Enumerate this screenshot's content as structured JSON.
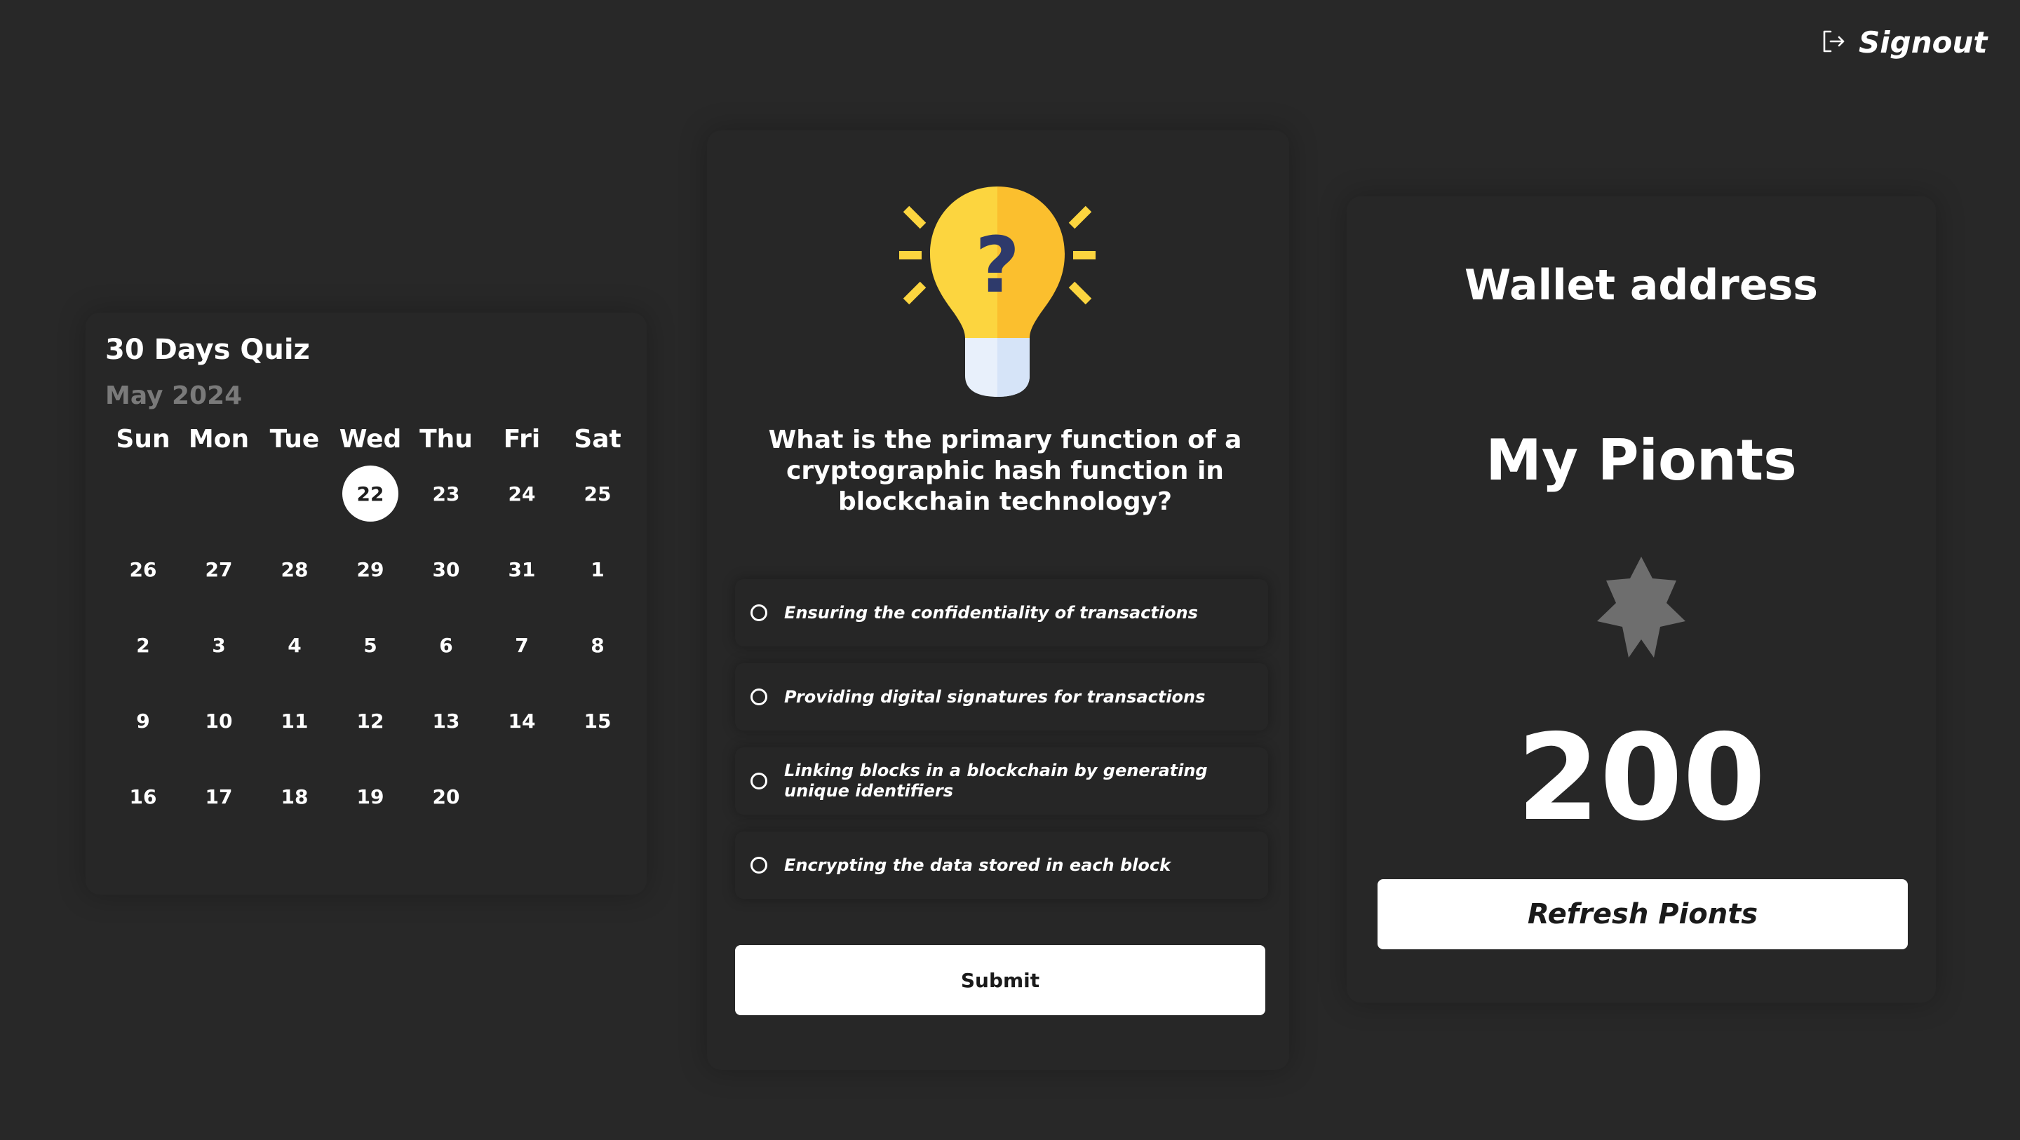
{
  "header": {
    "signout_label": "Signout",
    "signout_icon": "signout-icon"
  },
  "calendar": {
    "title": "30 Days Quiz",
    "month": "May 2024",
    "weekdays": [
      "Sun",
      "Mon",
      "Tue",
      "Wed",
      "Thu",
      "Fri",
      "Sat"
    ],
    "today": "22",
    "weeks": [
      [
        "",
        "",
        "",
        "22",
        "23",
        "24",
        "25"
      ],
      [
        "26",
        "27",
        "28",
        "29",
        "30",
        "31",
        "1"
      ],
      [
        "2",
        "3",
        "4",
        "5",
        "6",
        "7",
        "8"
      ],
      [
        "9",
        "10",
        "11",
        "12",
        "13",
        "14",
        "15"
      ],
      [
        "16",
        "17",
        "18",
        "19",
        "20",
        "",
        ""
      ]
    ]
  },
  "quiz": {
    "icon": "lightbulb-question-icon",
    "question": "What is the primary function of a cryptographic hash function in blockchain technology?",
    "options": [
      "Ensuring the confidentiality of transactions",
      "Providing digital signatures for transactions",
      "Linking blocks in a blockchain by generating unique identifiers",
      "Encrypting the data stored in each block"
    ],
    "submit_label": "Submit"
  },
  "wallet": {
    "title": "Wallet address",
    "points_title": "My Pionts",
    "points_icon": "star-icon",
    "points_value": "200",
    "refresh_label": "Refresh Pionts"
  },
  "colors": {
    "background": "#282828",
    "card": "#272727",
    "text": "#ffffff",
    "muted": "#7a7a7a",
    "bulb_yellow": "#fcd53f",
    "bulb_orange": "#fbbf2e",
    "bulb_base": "#e8f0fb",
    "question_mark": "#2e3a6b",
    "star_gray": "#6e6e6e"
  }
}
